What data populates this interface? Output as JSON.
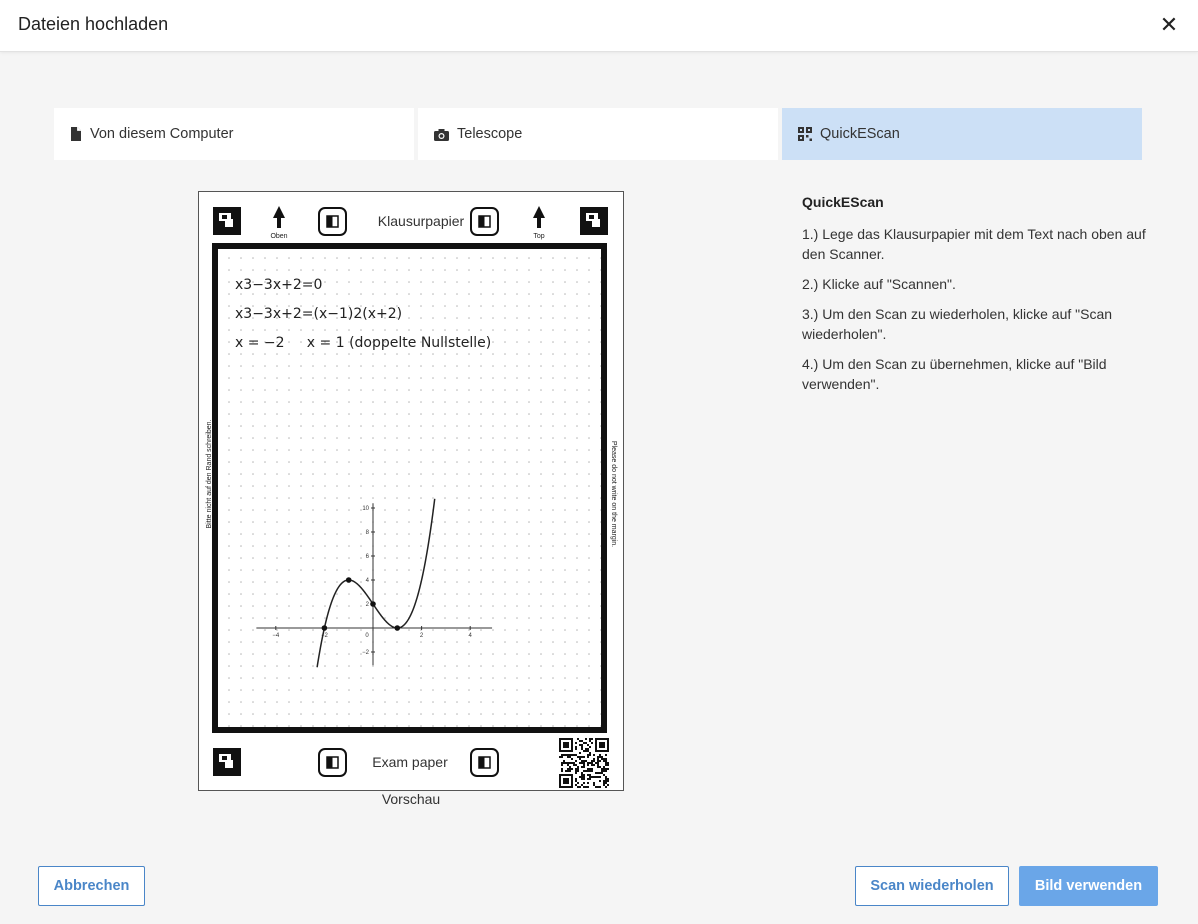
{
  "dialog": {
    "title": "Dateien hochladen"
  },
  "tabs": [
    {
      "label": "Von diesem Computer",
      "icon": "file-icon",
      "active": false
    },
    {
      "label": "Telescope",
      "icon": "camera-icon",
      "active": false
    },
    {
      "label": "QuickEScan",
      "icon": "qr-code-icon",
      "active": true
    }
  ],
  "preview": {
    "label": "Vorschau",
    "paper": {
      "top_label": "Klausurpapier",
      "bottom_label": "Exam paper",
      "arrow_left_label": "Oben",
      "arrow_right_label": "Top",
      "margin_left_text": "Bitte nicht auf den Rand schreiben.",
      "margin_right_text": "Please do not write on the margin.",
      "handwriting": [
        "x3−3x+2=0",
        "x3−3x+2=(x−1)2(x+2)",
        "x = −2     x = 1 (doppelte Nullstelle)"
      ]
    }
  },
  "chart_data": {
    "type": "line",
    "title": "",
    "xlabel": "",
    "ylabel": "",
    "function": "x^3 - 3x + 2",
    "xlim": [
      -5,
      5
    ],
    "ylim": [
      -3,
      10.5
    ],
    "x_ticks": [
      -4,
      -2,
      0,
      2,
      4
    ],
    "y_ticks": [
      -2,
      2,
      4,
      6,
      8,
      10
    ],
    "x_tick_labels": [
      "−4",
      "−2",
      "0",
      "2",
      "4"
    ],
    "y_tick_labels": [
      "−2",
      "2",
      "4",
      "6",
      "8",
      "10"
    ],
    "grid": true,
    "highlighted_points": [
      {
        "x": -2,
        "y": 0
      },
      {
        "x": -1,
        "y": 4
      },
      {
        "x": 0,
        "y": 2
      },
      {
        "x": 1,
        "y": 0
      }
    ]
  },
  "instructions": {
    "heading": "QuickEScan",
    "steps": [
      "1.) Lege das Klausurpapier mit dem Text nach oben auf den Scanner.",
      "2.) Klicke auf \"Scannen\".",
      "3.) Um den Scan zu wiederholen, klicke auf \"Scan wiederholen\".",
      "4.) Um den Scan zu übernehmen, klicke auf \"Bild verwenden\"."
    ]
  },
  "buttons": {
    "cancel": "Abbrechen",
    "rescan": "Scan wiederholen",
    "use": "Bild verwenden"
  },
  "colors": {
    "accent": "#4a86c8",
    "primary_button": "#6aa6e8",
    "active_tab": "#cce0f6"
  }
}
